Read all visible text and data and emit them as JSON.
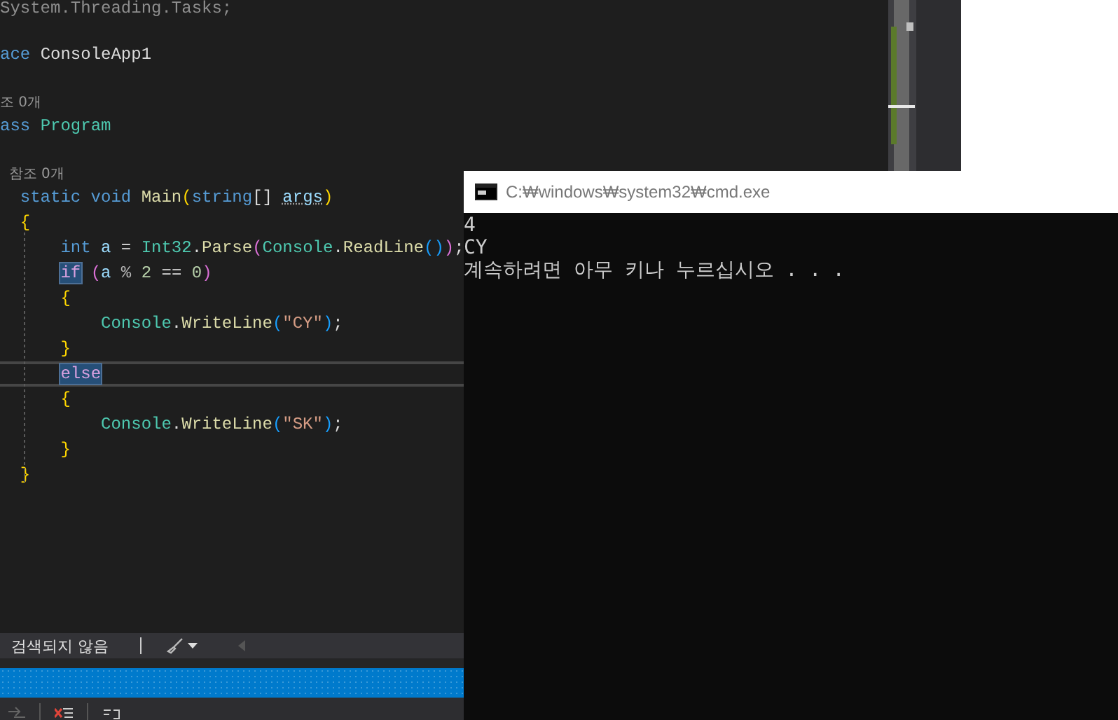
{
  "editor": {
    "lines": [
      {
        "kind": "code",
        "current": false,
        "tokens": [
          {
            "text": "System.Threading.Tasks;",
            "kind": "faded",
            "highlighted": false
          }
        ]
      },
      {
        "kind": "blank"
      },
      {
        "kind": "code",
        "current": false,
        "tokens": [
          {
            "text": "ace ",
            "kind": "keyword",
            "highlighted": false
          },
          {
            "text": "ConsoleApp1",
            "kind": "plain",
            "highlighted": false
          }
        ]
      },
      {
        "kind": "blank"
      },
      {
        "kind": "codelens",
        "text": "조 0개"
      },
      {
        "kind": "code",
        "current": false,
        "tokens": [
          {
            "text": "ass ",
            "kind": "keyword",
            "highlighted": false
          },
          {
            "text": "Program",
            "kind": "type",
            "highlighted": false
          }
        ]
      },
      {
        "kind": "blank"
      },
      {
        "kind": "codelens",
        "text": "  참조 0개"
      },
      {
        "kind": "code",
        "current": false,
        "tokens": [
          {
            "text": "  static void ",
            "kind": "keyword",
            "highlighted": false
          },
          {
            "text": "Main",
            "kind": "method",
            "highlighted": false
          },
          {
            "text": "(",
            "kind": "brace",
            "highlighted": false
          },
          {
            "text": "string",
            "kind": "keyword",
            "highlighted": false
          },
          {
            "text": "[] ",
            "kind": "plain",
            "highlighted": false
          },
          {
            "text": "args",
            "kind": "param",
            "highlighted": false
          },
          {
            "text": ")",
            "kind": "brace",
            "highlighted": false
          }
        ]
      },
      {
        "kind": "code",
        "current": false,
        "tokens": [
          {
            "text": "  {",
            "kind": "brace",
            "highlighted": false
          }
        ]
      },
      {
        "kind": "code",
        "current": false,
        "tokens": [
          {
            "text": "      int ",
            "kind": "keyword",
            "highlighted": false
          },
          {
            "text": "a",
            "kind": "variable",
            "highlighted": false
          },
          {
            "text": " = ",
            "kind": "plain",
            "highlighted": false
          },
          {
            "text": "Int32",
            "kind": "type",
            "highlighted": false
          },
          {
            "text": ".",
            "kind": "plain",
            "highlighted": false
          },
          {
            "text": "Parse",
            "kind": "method",
            "highlighted": false
          },
          {
            "text": "(",
            "kind": "brace2",
            "highlighted": false
          },
          {
            "text": "Console",
            "kind": "type",
            "highlighted": false
          },
          {
            "text": ".",
            "kind": "plain",
            "highlighted": false
          },
          {
            "text": "ReadLine",
            "kind": "method",
            "highlighted": false
          },
          {
            "text": "()",
            "kind": "brace3",
            "highlighted": false
          },
          {
            "text": ")",
            "kind": "brace2",
            "highlighted": false
          },
          {
            "text": ";",
            "kind": "plain",
            "highlighted": false
          }
        ]
      },
      {
        "kind": "code",
        "current": false,
        "tokens": [
          {
            "text": "      if",
            "kind": "control",
            "highlighted": true
          },
          {
            "text": " (",
            "kind": "brace2",
            "highlighted": false
          },
          {
            "text": "a",
            "kind": "variable",
            "highlighted": false
          },
          {
            "text": " % ",
            "kind": "op",
            "highlighted": false
          },
          {
            "text": "2",
            "kind": "number",
            "highlighted": false
          },
          {
            "text": " == ",
            "kind": "plain",
            "highlighted": false
          },
          {
            "text": "0",
            "kind": "number",
            "highlighted": false
          },
          {
            "text": ")",
            "kind": "brace2",
            "highlighted": false
          }
        ]
      },
      {
        "kind": "code",
        "current": false,
        "tokens": [
          {
            "text": "      {",
            "kind": "brace",
            "highlighted": false
          }
        ]
      },
      {
        "kind": "code",
        "current": false,
        "tokens": [
          {
            "text": "          Console",
            "kind": "type",
            "highlighted": false
          },
          {
            "text": ".",
            "kind": "plain",
            "highlighted": false
          },
          {
            "text": "WriteLine",
            "kind": "method",
            "highlighted": false
          },
          {
            "text": "(",
            "kind": "brace3",
            "highlighted": false
          },
          {
            "text": "\"CY\"",
            "kind": "string",
            "highlighted": false
          },
          {
            "text": ")",
            "kind": "brace3",
            "highlighted": false
          },
          {
            "text": ";",
            "kind": "plain",
            "highlighted": false
          }
        ]
      },
      {
        "kind": "code",
        "current": false,
        "tokens": [
          {
            "text": "      }",
            "kind": "brace",
            "highlighted": false
          }
        ]
      },
      {
        "kind": "code",
        "current": true,
        "tokens": [
          {
            "text": "      else",
            "kind": "control",
            "highlighted": true
          }
        ]
      },
      {
        "kind": "code",
        "current": false,
        "tokens": [
          {
            "text": "      {",
            "kind": "brace",
            "highlighted": false
          }
        ]
      },
      {
        "kind": "code",
        "current": false,
        "tokens": [
          {
            "text": "          Console",
            "kind": "type",
            "highlighted": false
          },
          {
            "text": ".",
            "kind": "plain",
            "highlighted": false
          },
          {
            "text": "WriteLine",
            "kind": "method",
            "highlighted": false
          },
          {
            "text": "(",
            "kind": "brace3",
            "highlighted": false
          },
          {
            "text": "\"SK\"",
            "kind": "string",
            "highlighted": false
          },
          {
            "text": ")",
            "kind": "brace3",
            "highlighted": false
          },
          {
            "text": ";",
            "kind": "plain",
            "highlighted": false
          }
        ]
      },
      {
        "kind": "code",
        "current": false,
        "tokens": [
          {
            "text": "      }",
            "kind": "brace",
            "highlighted": false
          }
        ]
      },
      {
        "kind": "code",
        "current": false,
        "tokens": [
          {
            "text": "  }",
            "kind": "brace",
            "highlighted": false
          }
        ]
      }
    ]
  },
  "find_bar": {
    "message": "검색되지 않음"
  },
  "console": {
    "title": "C:₩windows₩system32₩cmd.exe",
    "output": [
      "4",
      "CY",
      "계속하려면 아무 키나 누르십시오 . . ."
    ]
  }
}
